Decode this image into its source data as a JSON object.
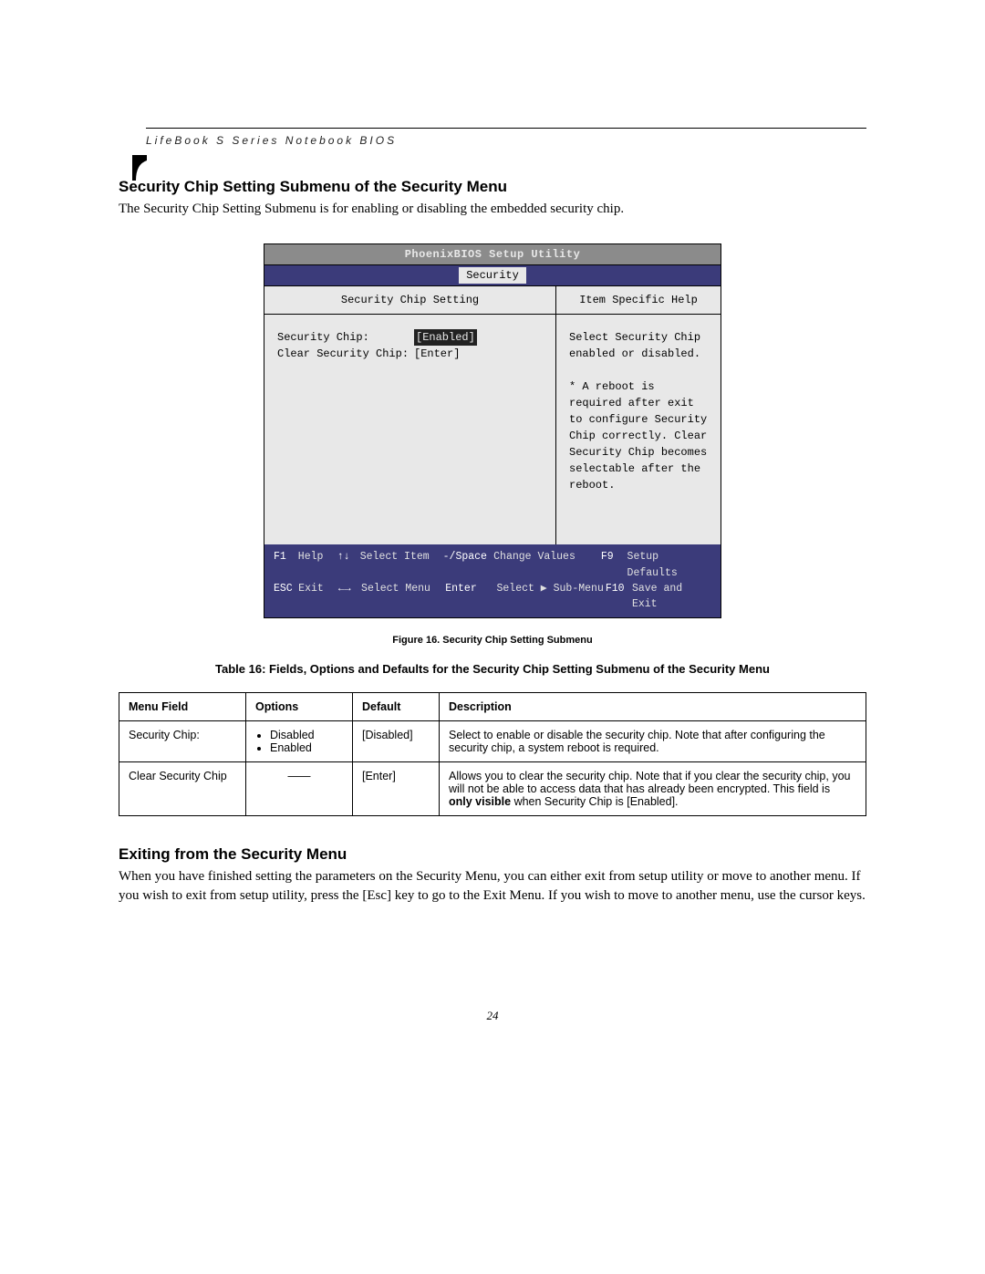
{
  "running_head": "LifeBook S Series Notebook BIOS",
  "section_title": "Security Chip Setting Submenu of the Security Menu",
  "section_body": "The Security Chip Setting Submenu is for enabling or disabling the embedded security chip.",
  "bios": {
    "title": "PhoenixBIOS Setup Utility",
    "tab": "Security",
    "main_heading": "Security Chip Setting",
    "help_heading": "Item Specific Help",
    "rows": [
      {
        "label": "Security Chip:",
        "value": "[Enabled]",
        "selected": true
      },
      {
        "label": "Clear Security Chip:",
        "value": "[Enter]",
        "selected": false
      }
    ],
    "help_text": "Select Security Chip enabled or disabled.\n\n* A reboot is required after exit to configure Security Chip correctly. Clear Security Chip becomes selectable after the reboot.",
    "footer": {
      "r1": {
        "k1": "F1",
        "v1": "Help",
        "k2": "↑↓",
        "v2": "Select Item",
        "k3": "-/Space",
        "v3": "Change Values",
        "k4": "F9",
        "v4": "Setup Defaults"
      },
      "r2": {
        "k1": "ESC",
        "v1": "Exit",
        "k2": "←→",
        "v2": "Select Menu",
        "k3": "Enter",
        "v3": "Select ▶ Sub-Menu",
        "k4": "F10",
        "v4": "Save and Exit"
      }
    }
  },
  "figure_caption": "Figure 16.  Security Chip Setting Submenu",
  "table_caption": "Table 16: Fields, Options and Defaults for the Security Chip Setting Submenu of the Security Menu",
  "table": {
    "headers": {
      "menu": "Menu Field",
      "options": "Options",
      "default": "Default",
      "description": "Description"
    },
    "rows": [
      {
        "menu": "Security Chip:",
        "options": [
          "Disabled",
          "Enabled"
        ],
        "default": "[Disabled]",
        "description": "Select to enable or disable the security chip. Note that after configuring the security chip, a system reboot is required."
      },
      {
        "menu": "Clear Security Chip",
        "options": null,
        "default": "[Enter]",
        "desc_pre": "Allows you to clear the security chip. Note that if you clear the security chip, you will not be able to access data that has already been encrypted. This field is ",
        "desc_bold": "only visible",
        "desc_post": " when Security Chip is [Enabled]."
      }
    ]
  },
  "exit_title": "Exiting from the Security Menu",
  "exit_body": "When you have finished setting the parameters on the Security Menu, you can either exit from setup utility or move to another menu. If you wish to exit from setup utility, press the [Esc] key to go to the Exit Menu. If you wish to move to another menu, use the cursor keys.",
  "page_number": "24"
}
